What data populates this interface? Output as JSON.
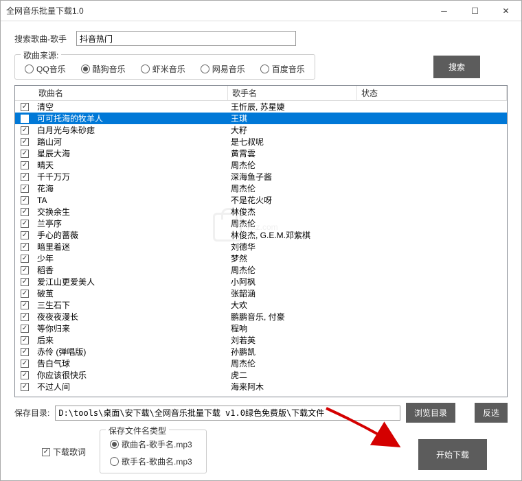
{
  "window": {
    "title": "全网音乐批量下载1.0"
  },
  "search": {
    "label": "搜索歌曲-歌手",
    "value": "抖音热门",
    "button": "搜索"
  },
  "source": {
    "legend": "歌曲来源:",
    "options": [
      "QQ音乐",
      "酷狗音乐",
      "虾米音乐",
      "网易音乐",
      "百度音乐"
    ],
    "selected": 1
  },
  "table": {
    "headers": {
      "song": "歌曲名",
      "artist": "歌手名",
      "status": "状态"
    },
    "rows": [
      {
        "song": "清空",
        "artist": "王忻辰, 苏星婕",
        "status": "",
        "checked": true,
        "selected": false
      },
      {
        "song": "可可托海的牧羊人",
        "artist": "王琪",
        "status": "",
        "checked": true,
        "selected": true
      },
      {
        "song": "白月光与朱砂痣",
        "artist": "大籽",
        "status": "",
        "checked": true,
        "selected": false
      },
      {
        "song": "踏山河",
        "artist": "是七叔呢",
        "status": "",
        "checked": true,
        "selected": false
      },
      {
        "song": "星辰大海",
        "artist": "黄霄雲",
        "status": "",
        "checked": true,
        "selected": false
      },
      {
        "song": "晴天",
        "artist": "周杰伦",
        "status": "",
        "checked": true,
        "selected": false
      },
      {
        "song": "千千万万",
        "artist": "深海鱼子酱",
        "status": "",
        "checked": true,
        "selected": false
      },
      {
        "song": "花海",
        "artist": "周杰伦",
        "status": "",
        "checked": true,
        "selected": false
      },
      {
        "song": "TA",
        "artist": "不是花火呀",
        "status": "",
        "checked": true,
        "selected": false
      },
      {
        "song": "交换余生",
        "artist": "林俊杰",
        "status": "",
        "checked": true,
        "selected": false
      },
      {
        "song": "兰亭序",
        "artist": "周杰伦",
        "status": "",
        "checked": true,
        "selected": false
      },
      {
        "song": "手心的蔷薇",
        "artist": "林俊杰, G.E.M.邓紫棋",
        "status": "",
        "checked": true,
        "selected": false
      },
      {
        "song": "暗里着迷",
        "artist": "刘德华",
        "status": "",
        "checked": true,
        "selected": false
      },
      {
        "song": "少年",
        "artist": "梦然",
        "status": "",
        "checked": true,
        "selected": false
      },
      {
        "song": "稻香",
        "artist": "周杰伦",
        "status": "",
        "checked": true,
        "selected": false
      },
      {
        "song": "爱江山更爱美人",
        "artist": "小阿枫",
        "status": "",
        "checked": true,
        "selected": false
      },
      {
        "song": "破茧",
        "artist": "张韶涵",
        "status": "",
        "checked": true,
        "selected": false
      },
      {
        "song": "三生石下",
        "artist": "大欢",
        "status": "",
        "checked": true,
        "selected": false
      },
      {
        "song": "夜夜夜漫长",
        "artist": "鹏鹏音乐, 付豪",
        "status": "",
        "checked": true,
        "selected": false
      },
      {
        "song": "等你归来",
        "artist": "程响",
        "status": "",
        "checked": true,
        "selected": false
      },
      {
        "song": "后来",
        "artist": "刘若英",
        "status": "",
        "checked": true,
        "selected": false
      },
      {
        "song": "赤伶 (弹唱版)",
        "artist": "孙鹏凯",
        "status": "",
        "checked": true,
        "selected": false
      },
      {
        "song": "告白气球",
        "artist": "周杰伦",
        "status": "",
        "checked": true,
        "selected": false
      },
      {
        "song": "你应该很快乐",
        "artist": "虎二",
        "status": "",
        "checked": true,
        "selected": false
      },
      {
        "song": "不过人间",
        "artist": "海来阿木",
        "status": "",
        "checked": true,
        "selected": false
      }
    ]
  },
  "save": {
    "label": "保存目录:",
    "path": "D:\\tools\\桌面\\安下载\\全网音乐批量下载 v1.0绿色免费版\\下载文件",
    "browse": "浏览目录",
    "invert": "反选"
  },
  "options": {
    "lyrics": "下载歌词",
    "lyrics_checked": true,
    "filename_legend": "保存文件名类型",
    "filename_options": [
      "歌曲名-歌手名.mp3",
      "歌手名-歌曲名.mp3"
    ],
    "filename_selected": 0
  },
  "start": {
    "label": "开始下载"
  },
  "watermark": "hxz.com"
}
